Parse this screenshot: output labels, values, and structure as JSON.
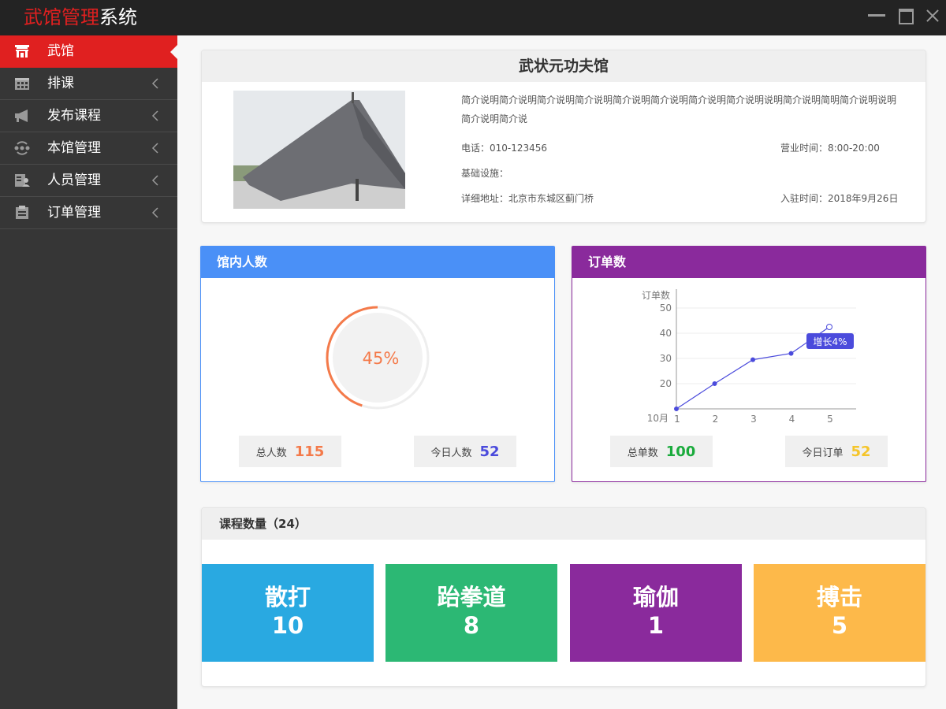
{
  "app": {
    "title_red": "武馆管理",
    "title_white": "系统"
  },
  "sidebar": {
    "items": [
      {
        "label": "武馆",
        "icon": "gate-icon",
        "active": true
      },
      {
        "label": "排课",
        "icon": "calendar-icon"
      },
      {
        "label": "发布课程",
        "icon": "megaphone-icon"
      },
      {
        "label": "本馆管理",
        "icon": "refresh-users-icon"
      },
      {
        "label": "人员管理",
        "icon": "staff-card-icon"
      },
      {
        "label": "订单管理",
        "icon": "clipboard-icon"
      }
    ]
  },
  "gym": {
    "name": "武状元功夫馆",
    "description": "简介说明简介说明简介说明简介说明简介说明简介说明简介说明简介说明说明简介说明简明简介说明说明简介说明简介说",
    "phone": "电话：010-123456",
    "hours": "营业时间：8:00-20:00",
    "facilities": "基础设施：",
    "address": "详细地址：北京市东城区蓟门桥",
    "join_date": "入驻时间：2018年9月26日"
  },
  "people": {
    "title": "馆内人数",
    "percent": 45,
    "percent_label": "45%",
    "total_label": "总人数",
    "total_value": "115",
    "today_label": "今日人数",
    "today_value": "52"
  },
  "orders": {
    "title": "订单数",
    "total_label": "总单数",
    "total_value": "100",
    "today_label": "今日订单",
    "today_value": "52"
  },
  "chart_data": {
    "type": "line",
    "ylabel": "订单数",
    "xlabel": "10月",
    "x": [
      1,
      2,
      3,
      4,
      5
    ],
    "values": [
      10,
      20,
      29.5,
      32,
      42.5
    ],
    "ylim": [
      10,
      50
    ],
    "yticks": [
      20,
      30,
      40,
      50
    ],
    "grid": true,
    "tooltip": "增长4%",
    "colors": {
      "line": "#4b4bdc",
      "tooltip": "#4b4bdc"
    }
  },
  "courses": {
    "title": "课程数量（24）",
    "items": [
      {
        "name": "散打",
        "count": "10",
        "color": "#29a9e1"
      },
      {
        "name": "跆拳道",
        "count": "8",
        "color": "#2cb874"
      },
      {
        "name": "瑜伽",
        "count": "1",
        "color": "#8a2a9c"
      },
      {
        "name": "搏击",
        "count": "5",
        "color": "#fdb94a"
      }
    ]
  },
  "colors": {
    "accent_red": "#e02020",
    "orange": "#f47a4a",
    "blue_value": "#4b4bdc",
    "green_value": "#1aab3c",
    "yellow_value": "#f5c52a"
  }
}
